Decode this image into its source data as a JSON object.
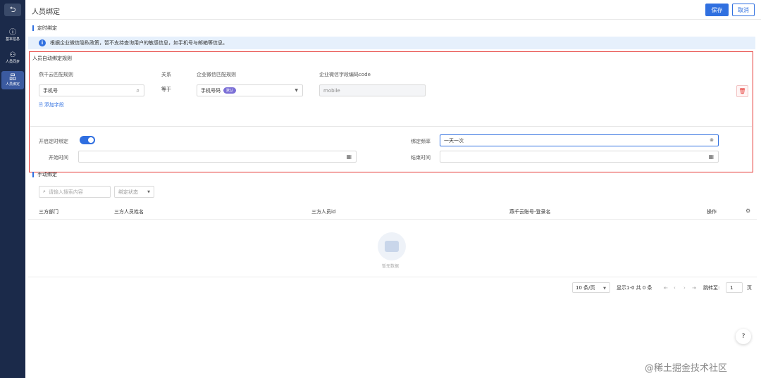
{
  "sidebar": {
    "back_icon": "undo-arrow-icon",
    "items": [
      {
        "icon": "info-icon",
        "label": "基本信息"
      },
      {
        "icon": "user-sync-icon",
        "label": "人员同步"
      },
      {
        "icon": "org-binding-icon",
        "label": "人员绑定"
      }
    ],
    "active_index": 2
  },
  "header": {
    "title": "人员绑定",
    "save_label": "保存",
    "cancel_label": "取消"
  },
  "scheduled": {
    "section_title": "定时绑定",
    "notice": "根据企业微信隐私政策，暂不支持查询用户的敏感信息，如手机号与邮箱等信息。",
    "rule_title": "人员自动绑定规则",
    "col_match_rule": "燕千云匹配规则",
    "col_relation": "关系",
    "col_wecom_rule": "企业微信匹配规则",
    "col_wecom_code": "企业微信字段编码code",
    "match_value": "手机号",
    "relation_value": "等于",
    "wecom_value": "手机号码",
    "wecom_tag": "默认",
    "code_value": "mobile",
    "add_field": "添加字段",
    "enable_label": "开启定时绑定",
    "enabled": true,
    "frequency_label": "绑定频率",
    "frequency_value": "一天一次",
    "start_label": "开始时间",
    "end_label": "结束时间"
  },
  "manual": {
    "section_title": "手动绑定",
    "search_placeholder": "请输入搜索内容",
    "status_placeholder": "绑定状态",
    "columns": [
      "三方部门",
      "三方人员姓名",
      "三方人员id",
      "燕千云账号-登录名",
      "操作"
    ],
    "empty_text": "暂无数据"
  },
  "pagination": {
    "page_size": "10 条/页",
    "summary": "显示1-0 共 0 条",
    "jump_label": "跳转至:",
    "jump_value": "1",
    "page_unit": "页"
  },
  "credit": "@稀土掘金技术社区",
  "colors": {
    "primary": "#3070e0",
    "sidebar_bg": "#1b2a4a",
    "highlight_frame": "#e53935"
  }
}
